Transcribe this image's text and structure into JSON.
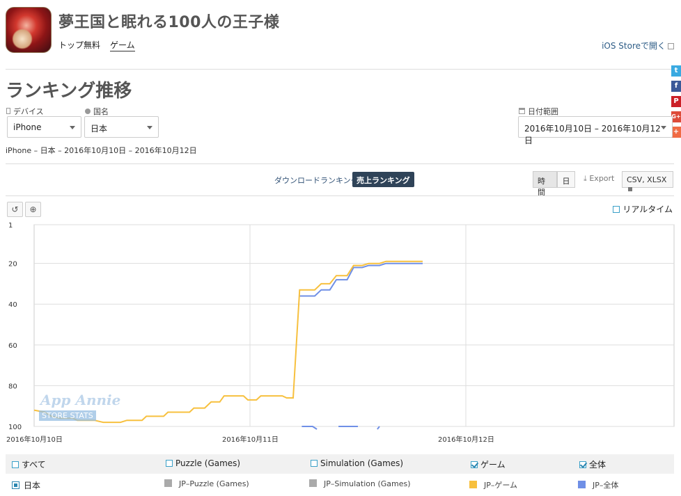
{
  "app": {
    "title": "夢王国と眠れる100人の王子様",
    "nav_top_free": "トップ無料",
    "nav_game": "ゲーム",
    "ios_store_link": "iOS Storeで開く"
  },
  "social": [
    "t",
    "f",
    "P",
    "G+",
    "+"
  ],
  "section_title": "ランキング推移",
  "filters": {
    "device_label": "デバイス",
    "device_value": "iPhone",
    "country_label": "国名",
    "country_value": "日本",
    "date_label": "日付範囲",
    "date_value": "2016年10月10日 – 2016年10月12日"
  },
  "summary": "iPhone – 日本 – 2016年10月10日 – 2016年10月12日",
  "tabs": {
    "download": "ダウンロードランキング",
    "sales": "売上ランキング"
  },
  "toolbar": {
    "hour": "時間",
    "day": "日",
    "export": "Export",
    "csv": "CSV, XLSX",
    "realtime": "リアルタイム"
  },
  "watermark": {
    "brand": "App Annie",
    "sub": "STORE STATS"
  },
  "chart_data": {
    "type": "line",
    "y_reversed": true,
    "ylim": [
      1,
      100
    ],
    "y_ticks": [
      "1",
      "20",
      "40",
      "60",
      "80",
      "100"
    ],
    "x_ticks": [
      "2016年10月10日",
      "2016年10月11日",
      "2016年10月12日"
    ],
    "colors": {
      "game": "#f7c03e",
      "overall": "#6f8fe6"
    },
    "series": [
      {
        "name": "JP-ゲーム",
        "points": [
          [
            0,
            92
          ],
          [
            0.05,
            93
          ],
          [
            0.08,
            95
          ],
          [
            0.12,
            96
          ],
          [
            0.18,
            96
          ],
          [
            0.2,
            97
          ],
          [
            0.28,
            97
          ],
          [
            0.32,
            98
          ],
          [
            0.4,
            98
          ],
          [
            0.43,
            97
          ],
          [
            0.5,
            97
          ],
          [
            0.52,
            95
          ],
          [
            0.6,
            95
          ],
          [
            0.62,
            93
          ],
          [
            0.72,
            93
          ],
          [
            0.74,
            91
          ],
          [
            0.79,
            91
          ],
          [
            0.82,
            88
          ],
          [
            0.86,
            88
          ],
          [
            0.88,
            85
          ],
          [
            0.97,
            85
          ],
          [
            0.99,
            87
          ],
          [
            1.03,
            87
          ],
          [
            1.05,
            85
          ],
          [
            1.15,
            85
          ],
          [
            1.17,
            86
          ],
          [
            1.2,
            86
          ],
          [
            1.23,
            33
          ],
          [
            1.3,
            33
          ],
          [
            1.33,
            30
          ],
          [
            1.37,
            30
          ],
          [
            1.4,
            26
          ],
          [
            1.45,
            26
          ],
          [
            1.48,
            21
          ],
          [
            1.52,
            21
          ],
          [
            1.55,
            20
          ],
          [
            1.6,
            20
          ],
          [
            1.63,
            19
          ],
          [
            1.8,
            19
          ]
        ]
      },
      {
        "name": "JP-全体",
        "points": [
          [
            1.23,
            36
          ],
          [
            1.3,
            36
          ],
          [
            1.33,
            33
          ],
          [
            1.37,
            33
          ],
          [
            1.4,
            28
          ],
          [
            1.45,
            28
          ],
          [
            1.48,
            22
          ],
          [
            1.52,
            22
          ],
          [
            1.55,
            21
          ],
          [
            1.6,
            21
          ],
          [
            1.63,
            20
          ],
          [
            1.8,
            20
          ]
        ]
      }
    ]
  },
  "legend": {
    "all": "すべて",
    "puzzle": "Puzzle (Games)",
    "simulation": "Simulation (Games)",
    "game": "ゲーム",
    "overall": "全体",
    "country": "日本",
    "jp_puzzle": "JP–Puzzle (Games)",
    "jp_simulation": "JP–Simulation (Games)",
    "jp_game": "JP–ゲーム",
    "jp_overall": "JP–全体"
  }
}
